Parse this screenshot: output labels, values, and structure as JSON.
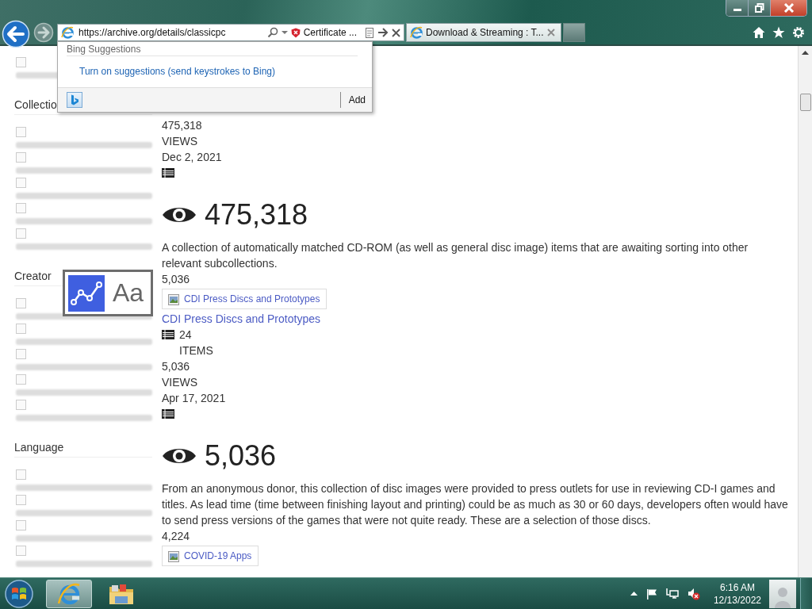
{
  "address_bar": {
    "url": "https://archive.org/details/classicpc",
    "certificate": "Certificate ..."
  },
  "tabs": [
    {
      "title": "Download & Streaming : T...",
      "selected": true
    }
  ],
  "suggestions": {
    "heading": "Bing Suggestions",
    "link": "Turn on suggestions (send keystrokes to Bing)",
    "button": "Add"
  },
  "sidebar": {
    "sections": [
      {
        "items": [
          {
            "checked": false
          }
        ]
      },
      {
        "heading": "Collectio",
        "items": [
          {
            "checked": false
          },
          {
            "checked": false
          },
          {
            "checked": false
          },
          {
            "checked": false
          },
          {
            "checked": false
          }
        ]
      },
      {
        "heading": "Creator",
        "items": [
          {
            "checked": false
          },
          {
            "checked": false
          },
          {
            "checked": false
          },
          {
            "checked": false
          },
          {
            "checked": false
          }
        ]
      },
      {
        "heading": "Language",
        "items": [
          {
            "checked": false
          },
          {
            "checked": false
          },
          {
            "checked": false
          },
          {
            "checked": false
          }
        ]
      }
    ]
  },
  "main": {
    "blocks": [
      {
        "kind": "text",
        "text": "475,318"
      },
      {
        "kind": "text",
        "text": "VIEWS"
      },
      {
        "kind": "text",
        "text": "Dec 2, 2021"
      },
      {
        "kind": "list_icon"
      },
      {
        "kind": "big_views",
        "text": "475,318"
      },
      {
        "kind": "description",
        "text": "A collection of automatically matched CD-ROM (as well as general disc image) items that are awaiting sorting into other relevant subcollections."
      },
      {
        "kind": "text",
        "text": "5,036"
      },
      {
        "kind": "card",
        "text": "CDI Press Discs and Prototypes"
      },
      {
        "kind": "link",
        "text": "CDI Press Discs and Prototypes"
      },
      {
        "kind": "item_count",
        "text": "24"
      },
      {
        "kind": "indented",
        "text": "ITEMS"
      },
      {
        "kind": "text",
        "text": "5,036"
      },
      {
        "kind": "text",
        "text": "VIEWS"
      },
      {
        "kind": "text",
        "text": "Apr 17, 2021"
      },
      {
        "kind": "list_icon"
      },
      {
        "kind": "big_views",
        "text": "5,036"
      },
      {
        "kind": "description",
        "text": "From an anonymous donor, this collection of disc images were provided to press outlets for use in reviewing CD-I games and titles. As lead time (time between finishing layout and printing) could be as much as 30 or 60 days, developers often would have to send press versions of the games that were not quite ready. These are a selection of those discs."
      },
      {
        "kind": "text",
        "text": "4,224"
      },
      {
        "kind": "card",
        "text": "COVID-19 Apps"
      }
    ]
  },
  "overlay": {
    "label": "Aa"
  },
  "taskbar": {
    "time": "6:16 AM",
    "date": "12/13/2022"
  }
}
